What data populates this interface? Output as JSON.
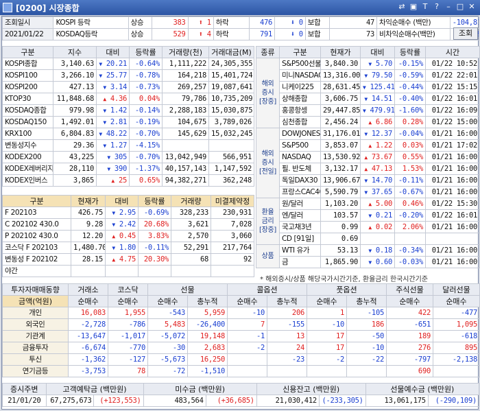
{
  "title": "[0200] 시장종합",
  "top": {
    "label1": "조회일시",
    "date": "2021/01/22",
    "rows": [
      {
        "name": "KOSPI 등락",
        "up_lbl": "상승",
        "up": "383",
        "up_cnt": "1",
        "down_lbl": "하락",
        "down": "476",
        "down_cnt": "0",
        "flat_lbl": "보합",
        "flat": "47",
        "net_lbl": "차익순매수 (백만)",
        "net": "-104,816"
      },
      {
        "name": "KOSDAQ등락",
        "up_lbl": "상승",
        "up": "529",
        "up_cnt": "4",
        "down_lbl": "하락",
        "down": "791",
        "down_cnt": "0",
        "flat_lbl": "보합",
        "flat": "73",
        "net_lbl": "비차익순매수(백만)",
        "net": "-622,798"
      }
    ],
    "query": "조회"
  },
  "idx": {
    "headers": [
      "구분",
      "지수",
      "대비",
      "등락률",
      "거래량(천)",
      "거래대금(M)"
    ],
    "rows": [
      [
        "KOSPI종합",
        "3,140.63",
        "20.21",
        "-0.64%",
        "1,111,222",
        "24,305,355",
        "d"
      ],
      [
        "KOSPI100",
        "3,266.10",
        "25.77",
        "-0.78%",
        "164,218",
        "15,401,724",
        "d"
      ],
      [
        "KOSPI200",
        "427.13",
        "3.14",
        "-0.73%",
        "269,257",
        "19,087,641",
        "d"
      ],
      [
        "KTOP30",
        "11,848.68",
        "4.36",
        "0.04%",
        "79,786",
        "10,735,209",
        "u"
      ],
      [
        "KOSDAQ종합",
        "979.98",
        "1.42",
        "-0.14%",
        "2,288,183",
        "15,030,875",
        "d"
      ],
      [
        "KOSDAQ150",
        "1,492.01",
        "2.81",
        "-0.19%",
        "104,675",
        "3,789,026",
        "d"
      ],
      [
        "KRX100",
        "6,804.83",
        "48.22",
        "-0.70%",
        "145,629",
        "15,032,245",
        "d"
      ],
      [
        "변동성지수",
        "29.36",
        "1.27",
        "-4.15%",
        "",
        "",
        "d"
      ],
      [
        "KODEX200",
        "43,225",
        "305",
        "-0.70%",
        "13,042,949",
        "566,951",
        "d"
      ],
      [
        "KODEX레버리지",
        "28,110",
        "390",
        "-1.37%",
        "40,157,143",
        "1,147,592",
        "d"
      ],
      [
        "KODEX인버스",
        "3,865",
        "25",
        "0.65%",
        "94,382,271",
        "362,248",
        "u"
      ]
    ]
  },
  "fut": {
    "headers": [
      "구분",
      "현재가",
      "대비",
      "등락률",
      "거래량",
      "미결제약정"
    ],
    "rows": [
      [
        "F 202103",
        "426.75",
        "2.95",
        "-0.69%",
        "328,233",
        "230,931",
        "d"
      ],
      [
        "C 202102 430.0",
        "9.28",
        "2.42",
        "20.68%",
        "3,621",
        "7,028",
        "d"
      ],
      [
        "P 202102 430.0",
        "12.20",
        "0.45",
        "3.83%",
        "2,570",
        "3,060",
        "u"
      ],
      [
        "코스닥 F 202103",
        "1,480.70",
        "1.80",
        "-0.11%",
        "52,291",
        "217,764",
        "d"
      ],
      [
        "변동성 F 202102",
        "28.15",
        "4.75",
        "20.30%",
        "68",
        "92",
        "u"
      ],
      [
        "야간",
        "",
        "",
        "",
        "",
        "",
        ""
      ]
    ]
  },
  "world": {
    "headers": [
      "종류",
      "구분",
      "현재가",
      "대비",
      "등락률",
      "시간"
    ],
    "groups": [
      {
        "name": "해외\n증시\n[장중]",
        "rows": [
          [
            "S&P500선물",
            "3,840.30",
            "5.70",
            "-0.15%",
            "01/22 10:52",
            "d"
          ],
          [
            "미니NASDAQ",
            "13,316.00",
            "79.50",
            "-0.59%",
            "01/22 22:01",
            "d"
          ],
          [
            "니케이225",
            "28,631.45",
            "125.41",
            "-0.44%",
            "01/22 15:15",
            "d"
          ],
          [
            "상해종합",
            "3,606.75",
            "14.51",
            "-0.40%",
            "01/22 16:01",
            "d"
          ],
          [
            "홍콩항셍",
            "29,447.85",
            "479.91",
            "-1.60%",
            "01/22 16:09",
            "d"
          ],
          [
            "심천종합",
            "2,456.24",
            "6.86",
            "0.28%",
            "01/22 15:00",
            "u"
          ]
        ]
      },
      {
        "name": "해외\n증시\n[전일]",
        "rows": [
          [
            "DOWJONES",
            "31,176.01",
            "12.37",
            "-0.04%",
            "01/21 16:00",
            "d"
          ],
          [
            "S&P500",
            "3,853.07",
            "1.22",
            "0.03%",
            "01/21 17:02",
            "u"
          ],
          [
            "NASDAQ",
            "13,530.92",
            "73.67",
            "0.55%",
            "01/21 16:00",
            "u"
          ],
          [
            "필. 반도체",
            "3,132.17",
            "47.13",
            "1.53%",
            "01/21 16:00",
            "u"
          ],
          [
            "독일DAX30",
            "13,906.67",
            "14.70",
            "-0.11%",
            "01/21 16:00",
            "d"
          ],
          [
            "프랑스CAC40",
            "5,590.79",
            "37.65",
            "-0.67%",
            "01/21 16:00",
            "d"
          ]
        ]
      },
      {
        "name": "환율\n금리\n[장중]",
        "rows": [
          [
            "원/달러",
            "1,103.20",
            "5.00",
            "0.46%",
            "01/22 15:30",
            "u"
          ],
          [
            "엔/달러",
            "103.57",
            "0.21",
            "-0.20%",
            "01/22 16:01",
            "d"
          ],
          [
            "국고채3년",
            "0.99",
            "0.02",
            "2.06%",
            "01/21 16:00",
            "u"
          ],
          [
            "CD [91일]",
            "0.69",
            "",
            "",
            "",
            ""
          ]
        ]
      },
      {
        "name": "상품",
        "rows": [
          [
            "WTI 유가",
            "53.13",
            "0.18",
            "-0.34%",
            "01/21 16:00",
            "d"
          ],
          [
            "금",
            "1,865.90",
            "0.60",
            "-0.03%",
            "01/21 16:00",
            "d"
          ]
        ]
      }
    ],
    "note": "* 해외증시/상품 해당국가시간기준, 환율금리 한국시간기준"
  },
  "inv": {
    "title": "투자자매매동향",
    "sub": "금액(억원)",
    "cols": [
      "거래소",
      "코스닥",
      "선물",
      "",
      "콜옵션",
      "",
      "풋옵션",
      "",
      "주식선물",
      "달러선물"
    ],
    "subcols": [
      "순매수",
      "순매수",
      "순매수",
      "총누적",
      "순매수",
      "총누적",
      "순매수",
      "총누적",
      "순매수",
      "순매수"
    ],
    "rows": [
      [
        "개인",
        "16,083",
        "1,955",
        "-543",
        "5,959",
        "-10",
        "206",
        "1",
        "-105",
        "422",
        "-477"
      ],
      [
        "외국인",
        "-2,728",
        "-786",
        "5,483",
        "-26,400",
        "7",
        "-155",
        "-10",
        "186",
        "-651",
        "1,095"
      ],
      [
        "기관계",
        "-13,647",
        "-1,017",
        "-5,072",
        "19,148",
        "-1",
        "13",
        "17",
        "-50",
        "189",
        "-618"
      ],
      [
        "금융투자",
        "-6,674",
        "-770",
        "-30",
        "2,683",
        "-2",
        "24",
        "17",
        "-10",
        "276",
        "895"
      ],
      [
        "투신",
        "-1,362",
        "-127",
        "-5,673",
        "16,250",
        "",
        "-23",
        "-2",
        "-22",
        "-797",
        "-2,138"
      ],
      [
        "연기금등",
        "-3,753",
        "78",
        "-72",
        "-1,510",
        "",
        "",
        "",
        "",
        "690",
        ""
      ]
    ]
  },
  "bottom": {
    "labels": [
      "증시주변",
      "고객예탁금 (백만원)",
      "미수금 (백만원)",
      "신용잔고 (백만원)",
      "선물예수금 (백만원)"
    ],
    "date": "21/01/20",
    "deposit": "67,275,673",
    "deposit_chg": "+123,553",
    "unpaid": "483,564",
    "unpaid_chg": "+36,685",
    "credit": "21,030,412",
    "credit_chg": "-233,305",
    "futdep": "13,061,175",
    "futdep_chg": "-290,109"
  }
}
